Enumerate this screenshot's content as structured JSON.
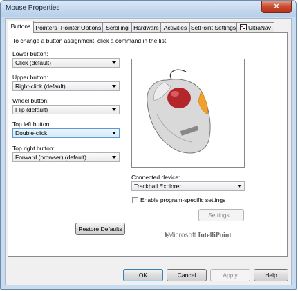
{
  "window": {
    "title": "Mouse Properties",
    "close_icon": "×"
  },
  "tabs": [
    {
      "label": "Buttons"
    },
    {
      "label": "Pointers"
    },
    {
      "label": "Pointer Options"
    },
    {
      "label": "Scrolling"
    },
    {
      "label": "Hardware"
    },
    {
      "label": "Activities"
    },
    {
      "label": "SetPoint Settings"
    },
    {
      "label": "UltraNav"
    }
  ],
  "buttons_tab": {
    "instruction": "To change a button assignment, click a command in the list.",
    "assignments": [
      {
        "label": "Lower button:",
        "value": "Click (default)"
      },
      {
        "label": "Upper button:",
        "value": "Right-click (default)"
      },
      {
        "label": "Wheel button:",
        "value": "Flip (default)"
      },
      {
        "label": "Top left button:",
        "value": "Double-click"
      },
      {
        "label": "Top right button:",
        "value": "Forward (browser) (default)"
      }
    ],
    "restore_defaults": "Restore Defaults",
    "connected_device_label": "Connected device:",
    "connected_device_value": "Trackball Explorer",
    "program_specific_label": "Enable program-specific settings",
    "program_specific_checked": false,
    "settings_button": "Settings...",
    "logo_text_1": "Microsoft",
    "logo_text_2": "IntelliPoint"
  },
  "footer": {
    "ok": "OK",
    "cancel": "Cancel",
    "apply": "Apply",
    "help": "Help"
  },
  "colors": {
    "trackball_red": "#b3262a",
    "accent_orange": "#f2a02a",
    "focus_blue": "#5b9bd5"
  }
}
